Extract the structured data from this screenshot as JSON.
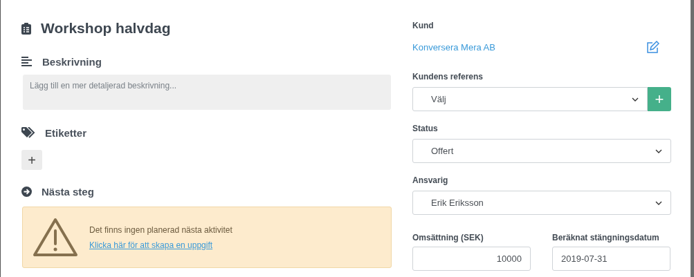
{
  "title": "Workshop halvdag",
  "description": {
    "heading": "Beskrivning",
    "placeholder": "Lägg till en mer detaljerad beskrivning..."
  },
  "tags": {
    "heading": "Etiketter",
    "add_button": "+"
  },
  "next_step": {
    "heading": "Nästa steg",
    "message": "Det finns ingen planerad nästa aktivitet",
    "link": "Klicka här för att skapa en uppgift"
  },
  "customer": {
    "label": "Kund",
    "name": "Konversera Mera AB"
  },
  "selects": [
    {
      "label": "Kundens referens",
      "value": "Välj",
      "add_button": "+"
    },
    {
      "label": "Status",
      "value": "Offert"
    },
    {
      "label": "Ansvarig",
      "value": "Erik Eriksson"
    }
  ],
  "revenue": {
    "label": "Omsättning (SEK)",
    "value": "10000"
  },
  "close_date": {
    "label": "Beräknat stängningsdatum",
    "value": "2019-07-31"
  }
}
